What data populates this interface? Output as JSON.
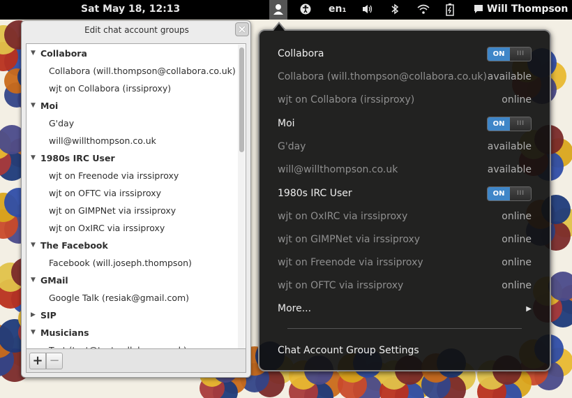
{
  "topbar": {
    "clock": "Sat May 18, 12:13",
    "keyboard_layout": "en₁",
    "user_name": "Will Thompson",
    "icons": [
      "user-icon",
      "accessibility-icon",
      "volume-icon",
      "bluetooth-icon",
      "wifi-icon",
      "battery-icon",
      "chat-bubble-icon"
    ]
  },
  "dialog": {
    "title": "Edit chat account groups",
    "close_label": "×",
    "add_label": "+",
    "remove_label": "−",
    "tree": [
      {
        "type": "group",
        "label": "Collabora",
        "expanded": true
      },
      {
        "type": "child",
        "label": "Collabora (will.thompson@collabora.co.uk)"
      },
      {
        "type": "child",
        "label": "wjt on Collabora (irssiproxy)"
      },
      {
        "type": "group",
        "label": "Moi",
        "expanded": true
      },
      {
        "type": "child",
        "label": "G'day"
      },
      {
        "type": "child",
        "label": "will@willthompson.co.uk"
      },
      {
        "type": "group",
        "label": "1980s IRC User",
        "expanded": true
      },
      {
        "type": "child",
        "label": "wjt on Freenode via irssiproxy"
      },
      {
        "type": "child",
        "label": "wjt on OFTC via irssiproxy"
      },
      {
        "type": "child",
        "label": "wjt on GIMPNet via irssiproxy"
      },
      {
        "type": "child",
        "label": "wjt on OxIRC via irssiproxy"
      },
      {
        "type": "group",
        "label": "The Facebook",
        "expanded": true
      },
      {
        "type": "child",
        "label": "Facebook (will.joseph.thompson)"
      },
      {
        "type": "group",
        "label": "GMail",
        "expanded": true
      },
      {
        "type": "child",
        "label": "Google Talk (resiak@gmail.com)"
      },
      {
        "type": "group",
        "label": "SIP",
        "expanded": false
      },
      {
        "type": "group",
        "label": "Musicians",
        "expanded": true
      },
      {
        "type": "child",
        "label": "Test (test@test.collabora.co.uk)"
      }
    ]
  },
  "menu": {
    "toggle_on_label": "ON",
    "toggle_knob_label": "III",
    "rows": [
      {
        "type": "group",
        "label": "Collabora",
        "toggle": "on"
      },
      {
        "type": "acct",
        "label": "Collabora (will.thompson@collabora.co.uk)",
        "status": "available"
      },
      {
        "type": "acct",
        "label": "wjt on Collabora (irssiproxy)",
        "status": "online"
      },
      {
        "type": "group",
        "label": "Moi",
        "toggle": "on"
      },
      {
        "type": "acct",
        "label": "G'day",
        "status": "available"
      },
      {
        "type": "acct",
        "label": "will@willthompson.co.uk",
        "status": "available"
      },
      {
        "type": "group",
        "label": "1980s IRC User",
        "toggle": "on"
      },
      {
        "type": "acct",
        "label": "wjt on OxIRC via irssiproxy",
        "status": "online"
      },
      {
        "type": "acct",
        "label": "wjt on GIMPNet via irssiproxy",
        "status": "online"
      },
      {
        "type": "acct",
        "label": "wjt on Freenode via irssiproxy",
        "status": "online"
      },
      {
        "type": "acct",
        "label": "wjt on OFTC via irssiproxy",
        "status": "online"
      }
    ],
    "more_label": "More...",
    "settings_label": "Chat Account Group Settings"
  },
  "colors": {
    "toggle_on": "#3f86c8",
    "menu_bg": "#101010",
    "topbar_bg": "#000000"
  }
}
